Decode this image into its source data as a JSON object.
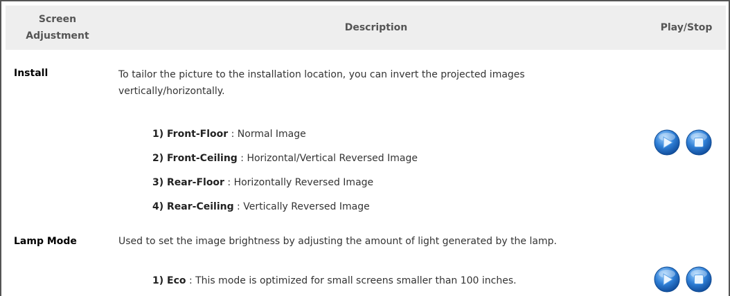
{
  "header": {
    "col1_line1": "Screen",
    "col1_line2": "Adjustment",
    "col2": "Description",
    "col3": "Play/Stop"
  },
  "rows": [
    {
      "label": "Install",
      "description": "To tailor the picture to the installation location, you can invert the projected images vertically/horizontally.",
      "items": [
        {
          "name": "1) Front-Floor",
          "text": " : Normal Image"
        },
        {
          "name": "2) Front-Ceiling",
          "text": " : Horizontal/Vertical Reversed Image"
        },
        {
          "name": "3) Rear-Floor",
          "text": " : Horizontally Reversed Image"
        },
        {
          "name": "4) Rear-Ceiling",
          "text": " : Vertically Reversed Image"
        }
      ]
    },
    {
      "label": "Lamp Mode",
      "description": "Used to set the image brightness by adjusting the amount of light generated by the lamp.",
      "items": [
        {
          "name": "1) Eco",
          "text": " : This mode is optimized for small screens smaller than 100 inches."
        }
      ]
    }
  ],
  "icons": {
    "play": "play-icon",
    "stop": "stop-icon"
  },
  "colors": {
    "button_blue": "#2f7fd6",
    "header_bg": "#eeeeee"
  }
}
